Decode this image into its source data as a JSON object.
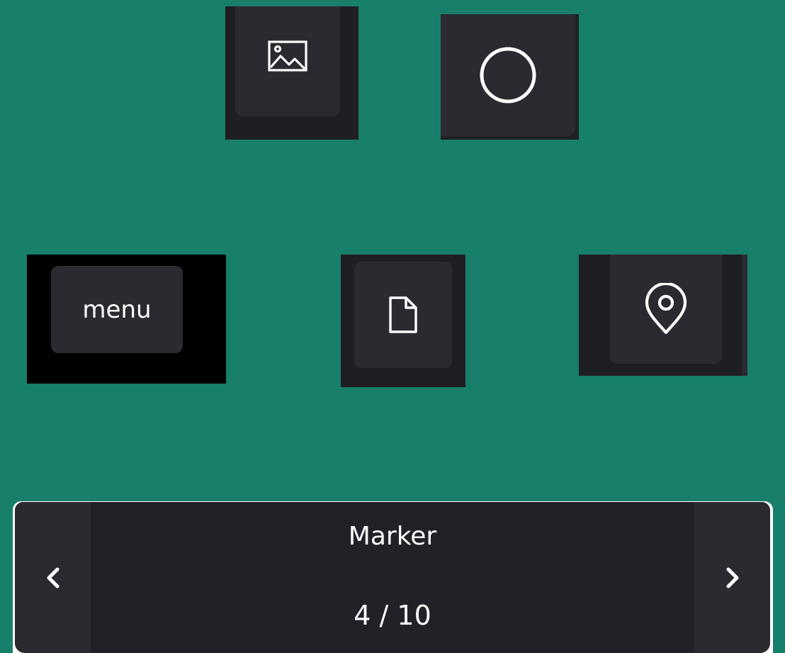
{
  "tiles": [
    {
      "id": "image",
      "icon": "image-icon"
    },
    {
      "id": "circle",
      "icon": "circle-icon"
    },
    {
      "id": "menu",
      "label": "menu"
    },
    {
      "id": "file",
      "icon": "file-icon"
    },
    {
      "id": "marker",
      "icon": "map-marker-icon"
    }
  ],
  "carousel": {
    "title": "Marker",
    "counter": "4 / 10",
    "prev_icon": "chevron-left-icon",
    "next_icon": "chevron-right-icon"
  },
  "colors": {
    "background": "#187f6a",
    "tile": "#2b2a30",
    "tile_frame": "#1f1e23",
    "panel": "#222127",
    "text": "#ffffff"
  }
}
